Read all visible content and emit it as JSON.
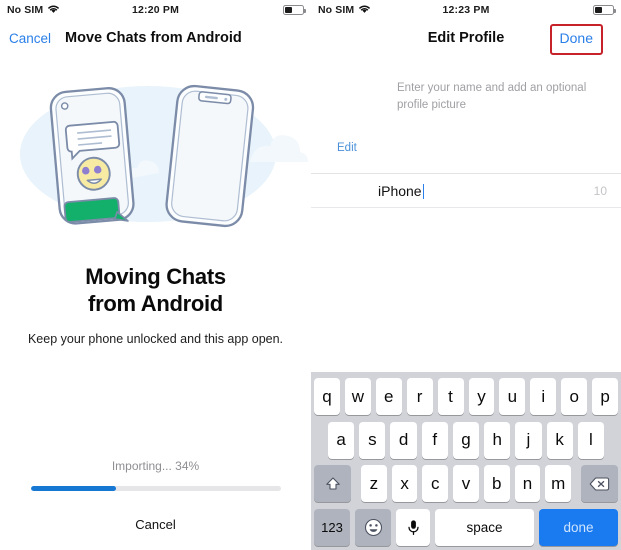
{
  "left_panel": {
    "statusbar": {
      "carrier": "No SIM",
      "wifi_icon": "wifi-icon",
      "time": "12:20 PM",
      "battery_icon": "battery-icon",
      "battery_level_pct": 40
    },
    "navbar": {
      "cancel_label": "Cancel",
      "title": "Move Chats from Android"
    },
    "illustration": {
      "name": "two-phones-chat-transfer-illustration",
      "android_phone": "android-phone",
      "iphone": "iphone",
      "emoji": "heart-eyes-emoji",
      "bubbles": [
        "incoming-message-bubble",
        "outgoing-message-bubble"
      ]
    },
    "headline_line1": "Moving Chats",
    "headline_line2": "from Android",
    "subtitle": "Keep your phone unlocked and this app open.",
    "progress": {
      "label": "Importing... 34%",
      "percent": 34,
      "fill_color": "#1778d4",
      "track_color": "#e6e6e8"
    },
    "cancel_bottom_label": "Cancel"
  },
  "right_panel": {
    "statusbar": {
      "carrier": "No SIM",
      "wifi_icon": "wifi-icon",
      "time": "12:23 PM",
      "battery_icon": "battery-icon",
      "battery_level_pct": 40
    },
    "navbar": {
      "title": "Edit Profile",
      "done_label": "Done",
      "done_highlight_color": "#c7222a"
    },
    "profile": {
      "avatar": "profile-avatar-placeholder",
      "hint": "Enter your name and add an optional profile picture",
      "edit_label": "Edit",
      "name_value": "iPhone",
      "char_count": "10"
    },
    "keyboard": {
      "row1": [
        "q",
        "w",
        "e",
        "r",
        "t",
        "y",
        "u",
        "i",
        "o",
        "p"
      ],
      "row2": [
        "a",
        "s",
        "d",
        "f",
        "g",
        "h",
        "j",
        "k",
        "l"
      ],
      "row3_letters": [
        "z",
        "x",
        "c",
        "v",
        "b",
        "n",
        "m"
      ],
      "shift_icon": "shift-icon",
      "backspace_icon": "backspace-icon",
      "numbers_label": "123",
      "emoji_icon": "emoji-icon",
      "mic_icon": "microphone-icon",
      "space_label": "space",
      "done_label": "done",
      "done_key_color": "#1a7af0"
    }
  }
}
